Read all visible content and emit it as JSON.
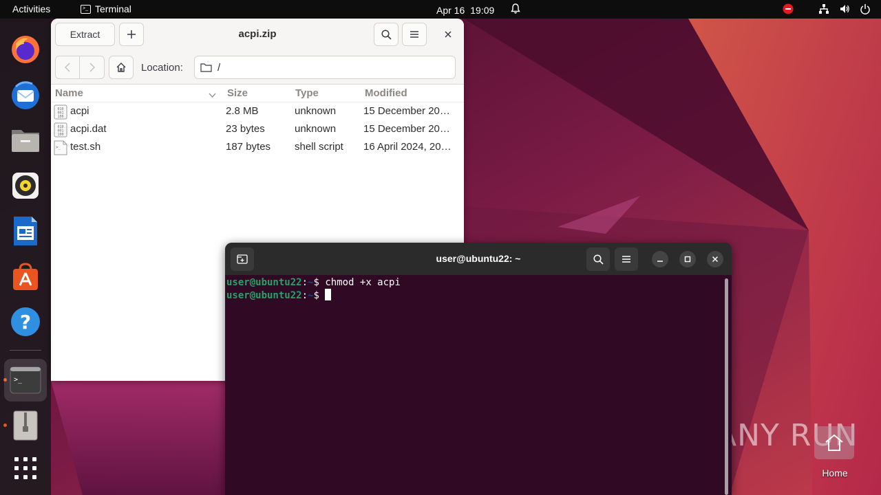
{
  "topbar": {
    "activities": "Activities",
    "app_name": "Terminal",
    "date": "Apr 16",
    "time": "19:09"
  },
  "dock": {
    "items": [
      {
        "name": "firefox-icon"
      },
      {
        "name": "thunderbird-icon"
      },
      {
        "name": "files-icon"
      },
      {
        "name": "rhythmbox-icon"
      },
      {
        "name": "libreoffice-writer-icon"
      },
      {
        "name": "app-center-icon"
      },
      {
        "name": "help-icon"
      },
      {
        "name": "terminal-icon"
      },
      {
        "name": "archive-manager-icon"
      },
      {
        "name": "show-apps-icon"
      }
    ]
  },
  "archive": {
    "title": "acpi.zip",
    "extract_label": "Extract",
    "location_label": "Location:",
    "location_value": "/",
    "columns": {
      "name": "Name",
      "size": "Size",
      "type": "Type",
      "modified": "Modified"
    },
    "rows": [
      {
        "name": "acpi",
        "size": "2.8 MB",
        "type": "unknown",
        "modified": "15 December 20…",
        "icon": "binary-file-icon"
      },
      {
        "name": "acpi.dat",
        "size": "23 bytes",
        "type": "unknown",
        "modified": "15 December 20…",
        "icon": "binary-file-icon"
      },
      {
        "name": "test.sh",
        "size": "187 bytes",
        "type": "shell script",
        "modified": "16 April 2024, 20…",
        "icon": "script-file-icon"
      }
    ]
  },
  "terminal": {
    "title": "user@ubuntu22: ~",
    "lines": [
      {
        "user": "user@ubuntu22",
        "sep": ":",
        "path": "~",
        "prompt": "$ ",
        "command": "chmod +x acpi"
      },
      {
        "user": "user@ubuntu22",
        "sep": ":",
        "path": "~",
        "prompt": "$ ",
        "command": ""
      }
    ]
  },
  "desktop": {
    "home_label": "Home",
    "watermark": "ANY RUN"
  },
  "colors": {
    "ubuntu_orange": "#e95420",
    "terminal_bg": "#300a24",
    "prompt_user": "#26a269",
    "prompt_path": "#12488b"
  }
}
